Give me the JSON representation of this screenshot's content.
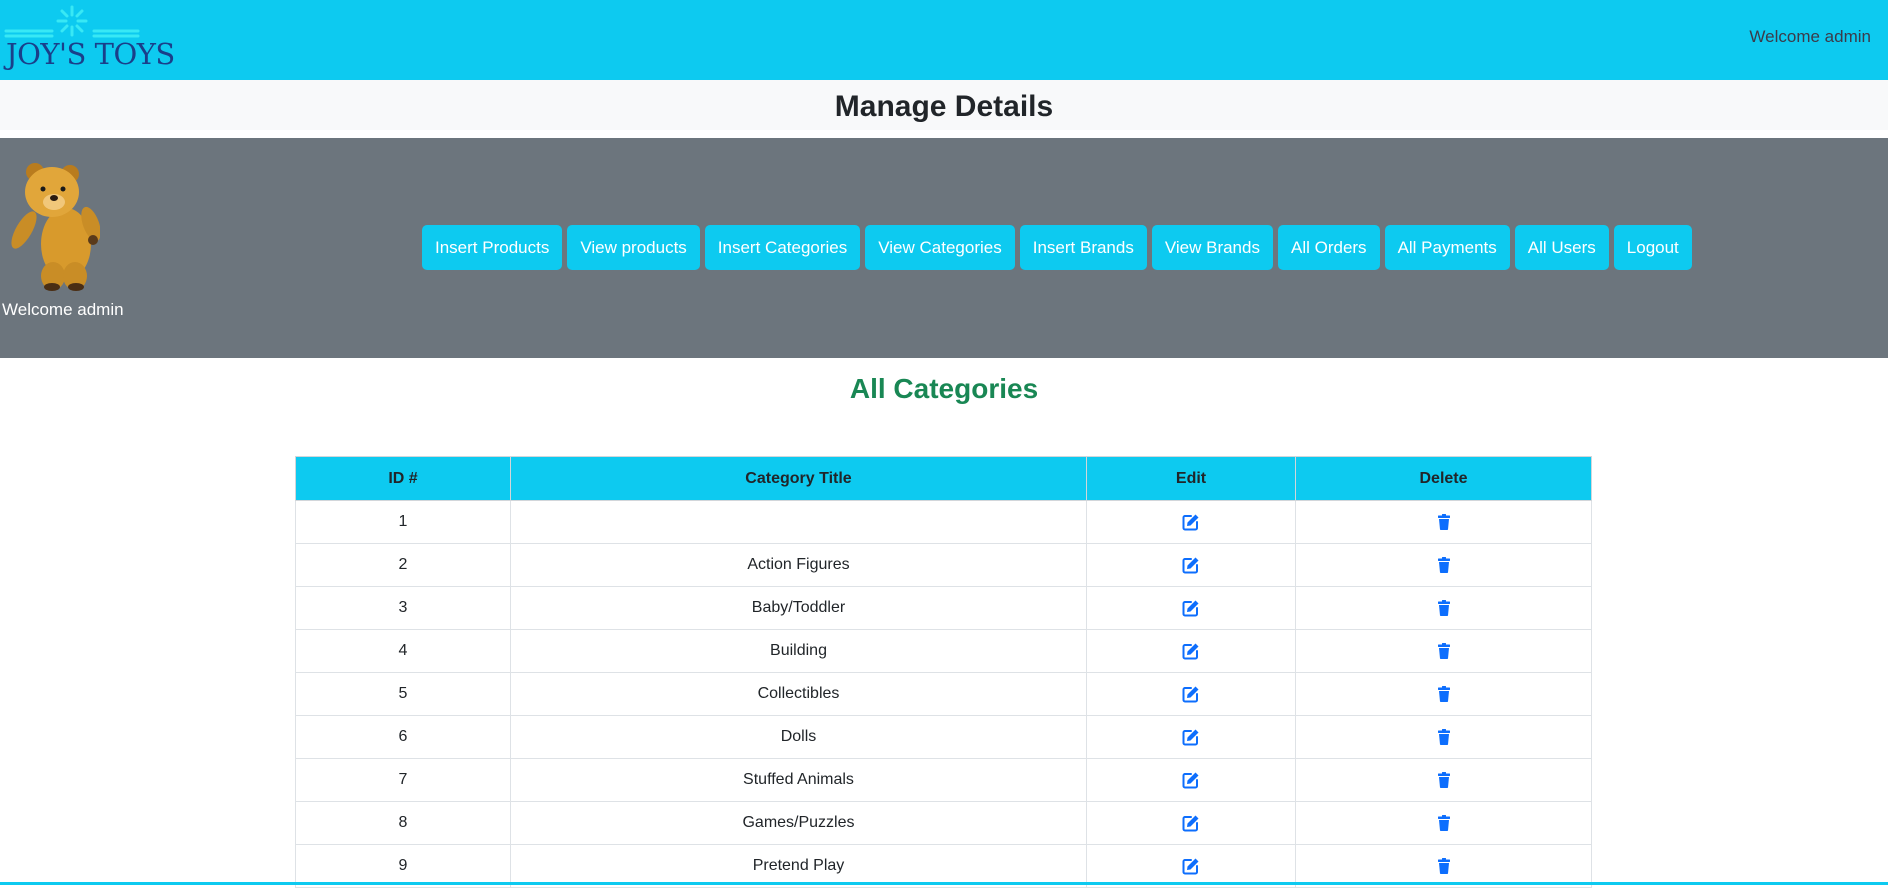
{
  "header": {
    "logo_text": "JOY'S TOYS",
    "welcome": "Welcome admin"
  },
  "page_heading": "Manage Details",
  "sidebar": {
    "welcome": "Welcome admin"
  },
  "nav_buttons": [
    "Insert Products",
    "View products",
    "Insert Categories",
    "View Categories",
    "Insert Brands",
    "View Brands",
    "All Orders",
    "All Payments",
    "All Users",
    "Logout"
  ],
  "section_title": "All Categories",
  "table": {
    "headers": [
      "ID #",
      "Category Title",
      "Edit",
      "Delete"
    ],
    "rows": [
      {
        "id": "1",
        "title": ""
      },
      {
        "id": "2",
        "title": "Action Figures"
      },
      {
        "id": "3",
        "title": "Baby/Toddler"
      },
      {
        "id": "4",
        "title": "Building"
      },
      {
        "id": "5",
        "title": "Collectibles"
      },
      {
        "id": "6",
        "title": "Dolls"
      },
      {
        "id": "7",
        "title": "Stuffed Animals"
      },
      {
        "id": "8",
        "title": "Games/Puzzles"
      },
      {
        "id": "9",
        "title": "Pretend Play"
      }
    ],
    "edit_icon": "edit-icon",
    "delete_icon": "trash-icon"
  },
  "colors": {
    "primary": "#0dcaf0",
    "panel": "#6c757d",
    "title_green": "#198754",
    "icon_blue": "#0d6efd",
    "logo_blue": "#1a3f8a"
  }
}
